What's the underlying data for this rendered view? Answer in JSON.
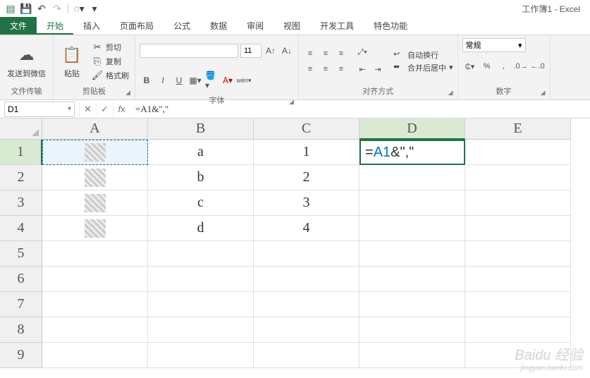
{
  "app": {
    "title": "工作簿1 - Excel"
  },
  "tabs": {
    "file": "文件",
    "home": "开始",
    "insert": "插入",
    "layout": "页面布局",
    "formulas": "公式",
    "data": "数据",
    "review": "审阅",
    "view": "视图",
    "dev": "开发工具",
    "special": "特色功能"
  },
  "ribbon": {
    "wechat": "发送到微信",
    "wechat_group": "文件传输",
    "paste": "粘贴",
    "cut": "剪切",
    "copy": "复制",
    "format_painter": "格式刷",
    "clipboard": "剪贴板",
    "font_name": "",
    "font_size": "11",
    "font_group": "字体",
    "wrap": "自动换行",
    "merge": "合并后居中",
    "align_group": "对齐方式",
    "number_format": "常规",
    "number_group": "数字"
  },
  "formula_bar": {
    "cell_ref": "D1",
    "formula": "=A1&\",\""
  },
  "columns": [
    "A",
    "B",
    "C",
    "D",
    "E"
  ],
  "rows": [
    "1",
    "2",
    "3",
    "4",
    "5",
    "6",
    "7",
    "8",
    "9"
  ],
  "cells": {
    "B1": "a",
    "C1": "1",
    "B2": "b",
    "C2": "2",
    "B3": "c",
    "C3": "3",
    "B4": "d",
    "C4": "4",
    "D1_prefix": "=",
    "D1_ref": "A1",
    "D1_suffix": "&\",\""
  },
  "selected": {
    "col": "D",
    "row": "1"
  },
  "watermark": {
    "main": "Baidu 经验",
    "sub": "jingyan.baidu.com"
  }
}
